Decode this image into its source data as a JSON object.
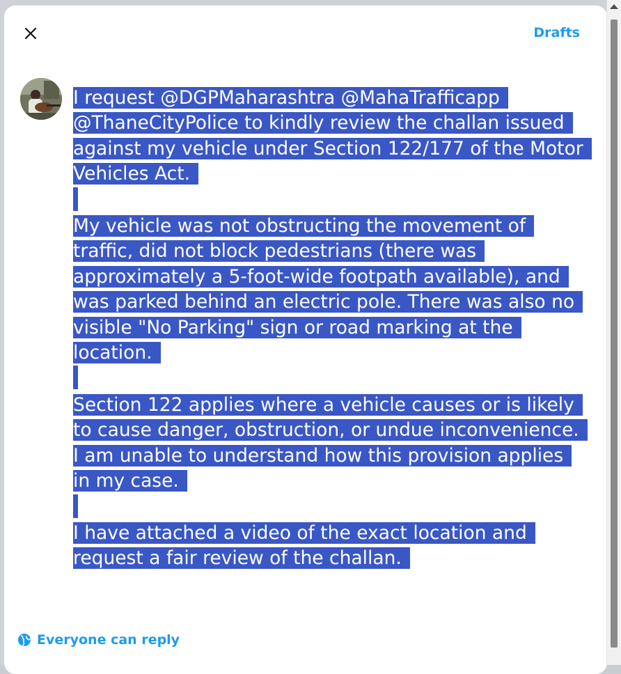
{
  "header": {
    "close_icon": "close-icon",
    "drafts_label": "Drafts"
  },
  "composer": {
    "avatar_icon": "user-avatar",
    "paragraphs": [
      [
        "I request @DGPMaharashtra @MahaTrafficapp",
        "@ThaneCityPolice to kindly review the challan issued",
        "against my vehicle under Section 122/177 of the Motor",
        "Vehicles Act."
      ],
      [
        "My vehicle was not obstructing the movement of",
        "traffic, did not block pedestrians (there was",
        "approximately a 5-foot-wide footpath available), and",
        "was parked behind an electric pole. There was also no",
        "visible \"No Parking\" sign or road marking at the",
        "location."
      ],
      [
        "Section 122 applies where a vehicle causes or is likely",
        "to cause danger, obstruction, or undue inconvenience.",
        "I am unable to understand how this provision applies",
        "in my case."
      ],
      [
        "I have attached a video of the exact location and",
        "request a fair review of the challan."
      ]
    ]
  },
  "footer": {
    "globe_icon": "globe-icon",
    "reply_setting_label": "Everyone can reply"
  },
  "colors": {
    "accent": "#1d9bf0",
    "selection": "#3a57c6"
  }
}
